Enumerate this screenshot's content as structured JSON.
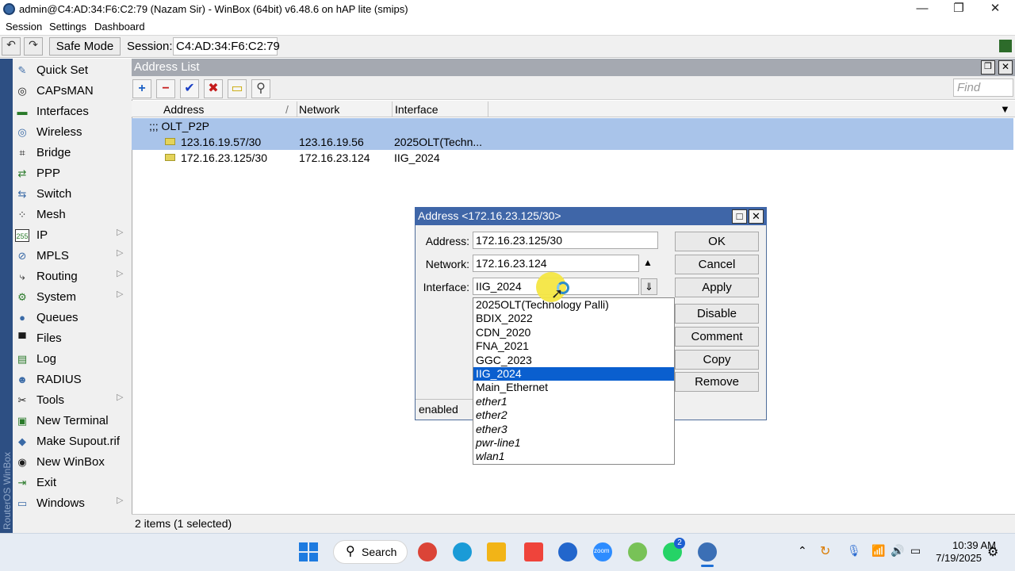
{
  "window": {
    "title": "admin@C4:AD:34:F6:C2:79 (Nazam Sir) - WinBox (64bit) v6.48.6 on hAP lite (smips)",
    "minimize_glyph": "—",
    "maximize_glyph": "❐",
    "close_glyph": "✕"
  },
  "menu": [
    "Session",
    "Settings",
    "Dashboard"
  ],
  "toolbar": {
    "undo_glyph": "↶",
    "redo_glyph": "↷",
    "safe_mode_label": "Safe Mode",
    "session_label": "Session:",
    "session_value": "C4:AD:34:F6:C2:79"
  },
  "side_strip_text": "RouterOS WinBox",
  "sidebar": {
    "items": [
      {
        "label": "Quick Set",
        "icon": "quick-set-icon",
        "glyph": "✎",
        "arrow": false
      },
      {
        "label": "CAPsMAN",
        "icon": "capsman-icon",
        "glyph": "◎",
        "arrow": false
      },
      {
        "label": "Interfaces",
        "icon": "interfaces-icon",
        "glyph": "▬",
        "arrow": false
      },
      {
        "label": "Wireless",
        "icon": "wireless-icon",
        "glyph": "◎",
        "arrow": false
      },
      {
        "label": "Bridge",
        "icon": "bridge-icon",
        "glyph": "⌗",
        "arrow": false
      },
      {
        "label": "PPP",
        "icon": "ppp-icon",
        "glyph": "⇄",
        "arrow": false
      },
      {
        "label": "Switch",
        "icon": "switch-icon",
        "glyph": "⇆",
        "arrow": false
      },
      {
        "label": "Mesh",
        "icon": "mesh-icon",
        "glyph": "⁘",
        "arrow": false
      },
      {
        "label": "IP",
        "icon": "ip-icon",
        "glyph": "255",
        "arrow": true
      },
      {
        "label": "MPLS",
        "icon": "mpls-icon",
        "glyph": "⊘",
        "arrow": true
      },
      {
        "label": "Routing",
        "icon": "routing-icon",
        "glyph": "⤷",
        "arrow": true
      },
      {
        "label": "System",
        "icon": "system-icon",
        "glyph": "⚙",
        "arrow": true
      },
      {
        "label": "Queues",
        "icon": "queues-icon",
        "glyph": "●",
        "arrow": false
      },
      {
        "label": "Files",
        "icon": "files-icon",
        "glyph": "▀",
        "arrow": false
      },
      {
        "label": "Log",
        "icon": "log-icon",
        "glyph": "▤",
        "arrow": false
      },
      {
        "label": "RADIUS",
        "icon": "radius-icon",
        "glyph": "☻",
        "arrow": false
      },
      {
        "label": "Tools",
        "icon": "tools-icon",
        "glyph": "✂",
        "arrow": true
      },
      {
        "label": "New Terminal",
        "icon": "terminal-icon",
        "glyph": "▣",
        "arrow": false
      },
      {
        "label": "Make Supout.rif",
        "icon": "supout-icon",
        "glyph": "◆",
        "arrow": false
      },
      {
        "label": "New WinBox",
        "icon": "winbox-icon",
        "glyph": "◉",
        "arrow": false
      },
      {
        "label": "Exit",
        "icon": "exit-icon",
        "glyph": "⇥",
        "arrow": false
      },
      {
        "label": "Windows",
        "icon": "windows-icon",
        "glyph": "▭",
        "arrow": true
      }
    ],
    "arrow_glyph": "▷"
  },
  "address_list": {
    "title": "Address List",
    "tools": [
      {
        "name": "add-icon",
        "glyph": "+",
        "color": "#1a5fc4"
      },
      {
        "name": "remove-icon",
        "glyph": "−",
        "color": "#c41a1a"
      },
      {
        "name": "enable-icon",
        "glyph": "✔",
        "color": "#1a3fc4"
      },
      {
        "name": "disable-icon",
        "glyph": "✖",
        "color": "#c41a1a"
      },
      {
        "name": "comment-icon",
        "glyph": "▭",
        "color": "#c8a800"
      },
      {
        "name": "filter-icon",
        "glyph": "⚲",
        "color": "#444444"
      }
    ],
    "find_placeholder": "Find",
    "columns": [
      "Address",
      "Network",
      "Interface"
    ],
    "sort_glyph": "/",
    "dropdown_glyph": "▼",
    "comment_row": ";;; OLT_P2P",
    "rows": [
      {
        "address": "123.16.19.57/30",
        "network": "123.16.19.56",
        "interface": "2025OLT(Techn...",
        "selected": true
      },
      {
        "address": "172.16.23.125/30",
        "network": "172.16.23.124",
        "interface": "IIG_2024",
        "selected": false
      }
    ],
    "status": "2 items (1 selected)"
  },
  "dialog": {
    "title": "Address <172.16.23.125/30>",
    "address_label": "Address:",
    "address_value": "172.16.23.125/30",
    "network_label": "Network:",
    "network_value": "172.16.23.124",
    "interface_label": "Interface:",
    "interface_value": "IIG_2024",
    "up_glyph": "▲",
    "down_glyph": "⇓",
    "buttons": [
      "OK",
      "Cancel",
      "Apply",
      "Disable",
      "Comment",
      "Copy",
      "Remove"
    ],
    "status": "enabled",
    "maximize_glyph": "□",
    "close_glyph": "✕"
  },
  "interface_options": [
    {
      "label": "2025OLT(Technology Palli)",
      "italic": false,
      "selected": false
    },
    {
      "label": "BDIX_2022",
      "italic": false,
      "selected": false
    },
    {
      "label": "CDN_2020",
      "italic": false,
      "selected": false
    },
    {
      "label": "FNA_2021",
      "italic": false,
      "selected": false
    },
    {
      "label": "GGC_2023",
      "italic": false,
      "selected": false
    },
    {
      "label": "IIG_2024",
      "italic": false,
      "selected": true
    },
    {
      "label": "Main_Ethernet",
      "italic": false,
      "selected": false
    },
    {
      "label": "ether1",
      "italic": true,
      "selected": false
    },
    {
      "label": "ether2",
      "italic": true,
      "selected": false
    },
    {
      "label": "ether3",
      "italic": true,
      "selected": false
    },
    {
      "label": "pwr-line1",
      "italic": true,
      "selected": false
    },
    {
      "label": "wlan1",
      "italic": true,
      "selected": false
    }
  ],
  "taskbar": {
    "search_label": "Search",
    "search_glyph": "⚲",
    "apps": [
      {
        "name": "start-icon",
        "color": "#1e7be0"
      },
      {
        "name": "chrome-icon",
        "color": "#db4437"
      },
      {
        "name": "edge-icon",
        "color": "#1a9bd7"
      },
      {
        "name": "file-explorer-icon",
        "color": "#f2b417"
      },
      {
        "name": "anydesk-icon",
        "color": "#ef443b"
      },
      {
        "name": "app-icon",
        "color": "#2266cc"
      },
      {
        "name": "zoom-icon",
        "color": "#2d8cff"
      },
      {
        "name": "android-studio-icon",
        "color": "#78c257"
      },
      {
        "name": "whatsapp-icon",
        "color": "#25d366"
      },
      {
        "name": "winbox-taskbar-icon",
        "color": "#3b6fb5"
      }
    ],
    "zoom_text": "zoom",
    "whatsapp_badge": "2",
    "tray_glyphs": [
      "⌃",
      "↻",
      "🎙",
      "📶",
      "🔊",
      "▭"
    ],
    "time": "10:39 AM",
    "date": "7/19/2025"
  }
}
